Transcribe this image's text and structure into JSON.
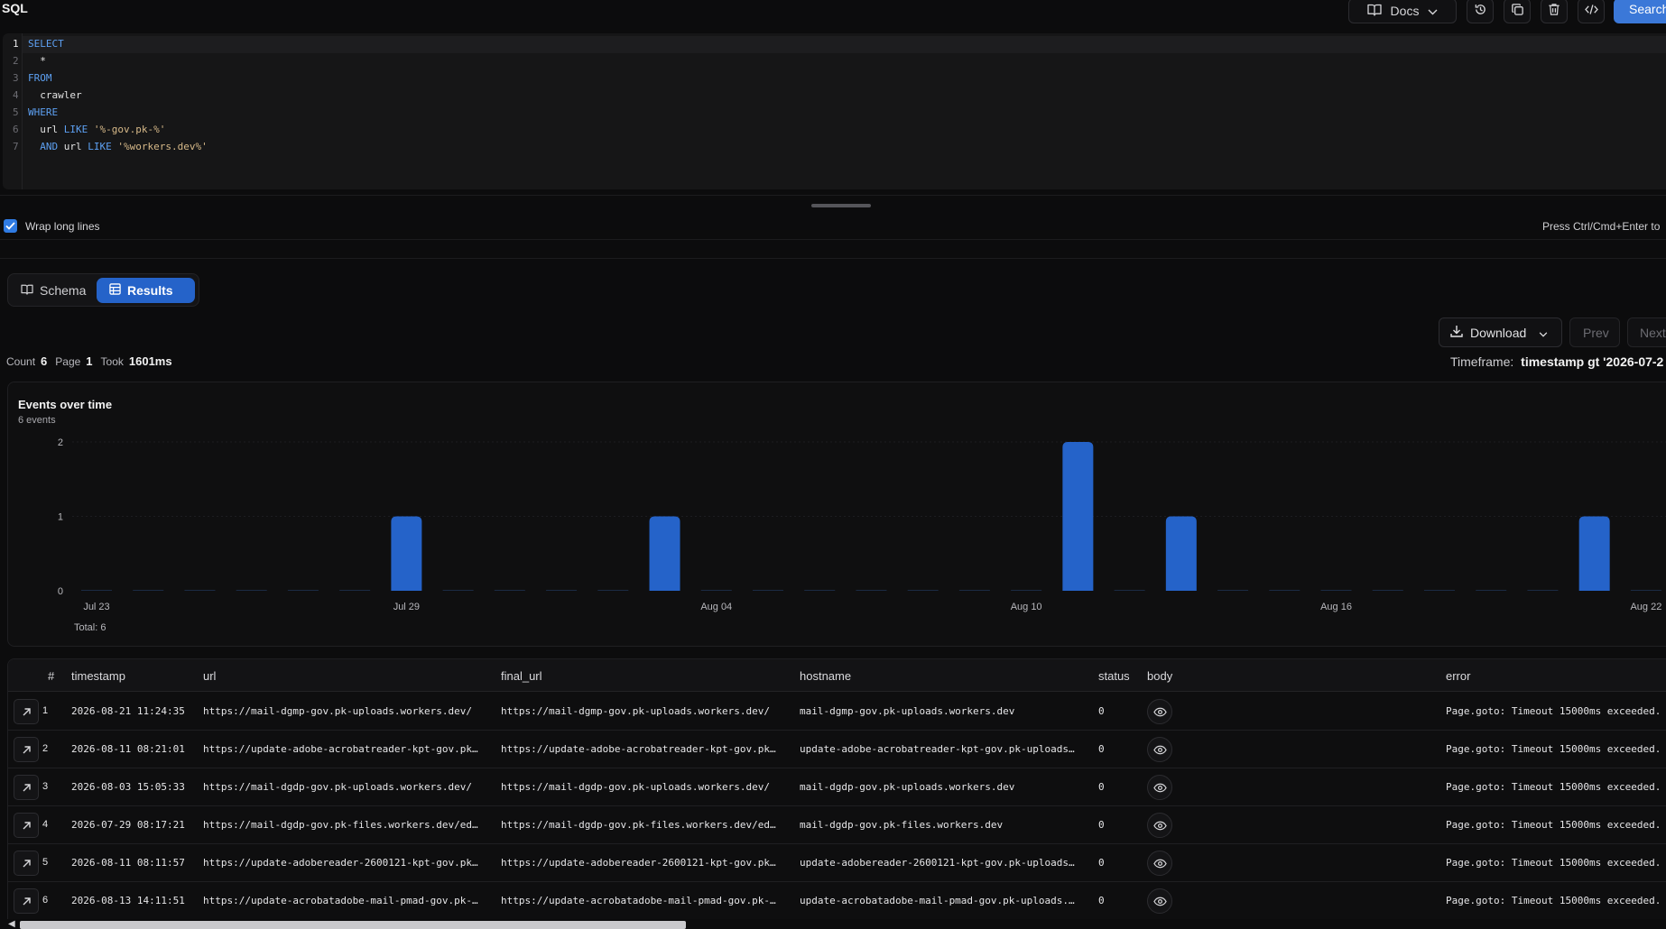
{
  "header": {
    "title": "SQL",
    "docs_label": "Docs",
    "search_label": "Search"
  },
  "editor": {
    "line_numbers": [
      "1",
      "2",
      "3",
      "4",
      "5",
      "6",
      "7"
    ],
    "lines": [
      [
        {
          "t": "SELECT",
          "c": "kw"
        }
      ],
      [
        {
          "t": "  *",
          "c": ""
        }
      ],
      [
        {
          "t": "FROM",
          "c": "kw"
        }
      ],
      [
        {
          "t": "  crawler",
          "c": ""
        }
      ],
      [
        {
          "t": "WHERE",
          "c": "kw"
        }
      ],
      [
        {
          "t": "  url ",
          "c": ""
        },
        {
          "t": "LIKE",
          "c": "kw"
        },
        {
          "t": " '%-gov.pk-%'",
          "c": "str"
        }
      ],
      [
        {
          "t": "  ",
          "c": ""
        },
        {
          "t": "AND",
          "c": "kw"
        },
        {
          "t": " url ",
          "c": ""
        },
        {
          "t": "LIKE",
          "c": "kw"
        },
        {
          "t": " '%workers.dev%'",
          "c": "str"
        }
      ]
    ]
  },
  "options": {
    "wrap_label": "Wrap long lines",
    "wrap_checked": true,
    "hint": "Press Ctrl/Cmd+Enter to"
  },
  "tabs": [
    {
      "label": "Schema",
      "active": false
    },
    {
      "label": "Results",
      "active": true
    }
  ],
  "results": {
    "download_label": "Download",
    "prev_label": "Prev",
    "next_label": "Next",
    "count_label": "Count",
    "count": "6",
    "page_label": "Page",
    "page": "1",
    "took_label": "Took",
    "took": "1601ms",
    "timeframe_label": "Timeframe:",
    "timeframe_value": "timestamp gt '2026-07-2"
  },
  "chart_data": {
    "type": "bar",
    "title": "Events over time",
    "subtitle": "6 events",
    "total_label": "Total: 6",
    "categories": [
      "Jul 23",
      "Jul 24",
      "Jul 25",
      "Jul 26",
      "Jul 27",
      "Jul 28",
      "Jul 29",
      "Jul 30",
      "Jul 31",
      "Aug 01",
      "Aug 02",
      "Aug 03",
      "Aug 04",
      "Aug 05",
      "Aug 06",
      "Aug 07",
      "Aug 08",
      "Aug 09",
      "Aug 10",
      "Aug 11",
      "Aug 12",
      "Aug 13",
      "Aug 14",
      "Aug 15",
      "Aug 16",
      "Aug 17",
      "Aug 18",
      "Aug 19",
      "Aug 20",
      "Aug 21",
      "Aug 22"
    ],
    "values": [
      0,
      0,
      0,
      0,
      0,
      0,
      1,
      0,
      0,
      0,
      0,
      1,
      0,
      0,
      0,
      0,
      0,
      0,
      0,
      2,
      0,
      1,
      0,
      0,
      0,
      0,
      0,
      0,
      0,
      1,
      0
    ],
    "x_ticks": [
      "Jul 23",
      "Jul 29",
      "Aug 04",
      "Aug 10",
      "Aug 16",
      "Aug 22"
    ],
    "y_ticks": [
      "0",
      "1",
      "2"
    ],
    "ylim": [
      0,
      2
    ],
    "grid": true,
    "color": "#2563c9"
  },
  "table": {
    "columns": [
      "#",
      "timestamp",
      "url",
      "final_url",
      "hostname",
      "status",
      "body",
      "error"
    ],
    "rows": [
      {
        "n": "1",
        "timestamp": "2026-08-21 11:24:35",
        "url": "https://mail-dgmp-gov.pk-uploads.workers.dev/",
        "final_url": "https://mail-dgmp-gov.pk-uploads.workers.dev/",
        "hostname": "mail-dgmp-gov.pk-uploads.workers.dev",
        "status": "0",
        "error": "Page.goto: Timeout 15000ms exceeded."
      },
      {
        "n": "2",
        "timestamp": "2026-08-11 08:21:01",
        "url": "https://update-adobe-acrobatreader-kpt-gov.pk…",
        "final_url": "https://update-adobe-acrobatreader-kpt-gov.pk…",
        "hostname": "update-adobe-acrobatreader-kpt-gov.pk-uploads…",
        "status": "0",
        "error": "Page.goto: Timeout 15000ms exceeded."
      },
      {
        "n": "3",
        "timestamp": "2026-08-03 15:05:33",
        "url": "https://mail-dgdp-gov.pk-uploads.workers.dev/",
        "final_url": "https://mail-dgdp-gov.pk-uploads.workers.dev/",
        "hostname": "mail-dgdp-gov.pk-uploads.workers.dev",
        "status": "0",
        "error": "Page.goto: Timeout 15000ms exceeded."
      },
      {
        "n": "4",
        "timestamp": "2026-07-29 08:17:21",
        "url": "https://mail-dgdp-gov.pk-files.workers.dev/ed…",
        "final_url": "https://mail-dgdp-gov.pk-files.workers.dev/ed…",
        "hostname": "mail-dgdp-gov.pk-files.workers.dev",
        "status": "0",
        "error": "Page.goto: Timeout 15000ms exceeded."
      },
      {
        "n": "5",
        "timestamp": "2026-08-11 08:11:57",
        "url": "https://update-adobereader-2600121-kpt-gov.pk…",
        "final_url": "https://update-adobereader-2600121-kpt-gov.pk…",
        "hostname": "update-adobereader-2600121-kpt-gov.pk-uploads…",
        "status": "0",
        "error": "Page.goto: Timeout 15000ms exceeded."
      },
      {
        "n": "6",
        "timestamp": "2026-08-13 14:11:51",
        "url": "https://update-acrobatadobe-mail-pmad-gov.pk-…",
        "final_url": "https://update-acrobatadobe-mail-pmad-gov.pk-…",
        "hostname": "update-acrobatadobe-mail-pmad-gov.pk-uploads.…",
        "status": "0",
        "error": "Page.goto: Timeout 15000ms exceeded."
      }
    ]
  },
  "icons": {
    "docs": "book-icon",
    "history": "history-icon",
    "copy": "copy-icon",
    "delete": "trash-icon",
    "code": "code-icon",
    "download": "download-icon",
    "expand": "arrow-up-right-icon",
    "body": "eye-icon"
  }
}
